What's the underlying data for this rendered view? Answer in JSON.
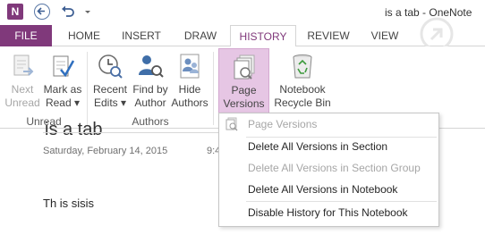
{
  "titlebar": {
    "app_logo": "N",
    "window_title": "is a tab  - OneNote",
    "icons": [
      "back-icon",
      "undo-icon",
      "customize-dropdown-icon"
    ]
  },
  "tabs": [
    {
      "label": "FILE"
    },
    {
      "label": "HOME"
    },
    {
      "label": "INSERT"
    },
    {
      "label": "DRAW"
    },
    {
      "label": "HISTORY",
      "active": true
    },
    {
      "label": "REVIEW"
    },
    {
      "label": "VIEW"
    }
  ],
  "ribbon": {
    "next_unread": {
      "line1": "Next",
      "line2": "Unread",
      "disabled": true
    },
    "mark_as_read": {
      "line1": "Mark as",
      "line2": "Read ▾"
    },
    "recent_edits": {
      "line1": "Recent",
      "line2": "Edits ▾"
    },
    "find_by_author": {
      "line1": "Find by",
      "line2": "Author"
    },
    "hide_authors": {
      "line1": "Hide",
      "line2": "Authors"
    },
    "page_versions": {
      "line1": "Page",
      "line2": "Versions ▾",
      "pressed": true
    },
    "notebook_recycle_bin": {
      "line1": "Notebook",
      "line2": "Recycle Bin ▾"
    },
    "groups": {
      "unread": "Unread",
      "authors": "Authors"
    }
  },
  "page": {
    "title": "is a tab",
    "date": "Saturday, February 14, 2015",
    "time": "9:4",
    "body": "Th is sisis"
  },
  "menu": {
    "items": [
      {
        "label": "Page Versions",
        "disabled": true
      },
      {
        "label": "Delete All Versions in Section",
        "disabled": false
      },
      {
        "label": "Delete All Versions in Section Group",
        "disabled": true
      },
      {
        "label": "Delete All Versions in Notebook",
        "disabled": false
      },
      {
        "label": "Disable History for This Notebook",
        "disabled": false
      }
    ]
  },
  "colors": {
    "accent": "#80397b",
    "pressed": "#e6c6e4",
    "disabled_text": "#a6a6a6"
  }
}
